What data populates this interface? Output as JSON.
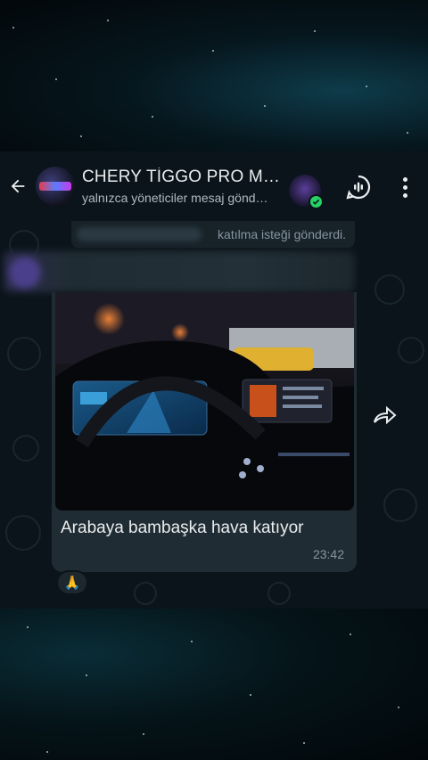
{
  "header": {
    "title": "CHERY TİGGO PRO M…",
    "subtitle": "yalnızca yöneticiler mesaj gönd…",
    "group_avatar_icon": "chery-tiggo-pro-logo",
    "member_badge_icon": "check-icon",
    "voice_chat_icon": "voice-chat-icon",
    "menu_icon": "more-vertical-icon"
  },
  "system_message": {
    "text": "katılma isteği gönderdi."
  },
  "message": {
    "caption": "Arabaya bambaşka hava katıyor",
    "time": "23:42",
    "reaction": "🙏"
  },
  "colors": {
    "header_bg": "#0b141a",
    "bubble_bg": "#202c33",
    "accent_green": "#25d366",
    "text_primary": "#e9edef",
    "text_secondary": "#8696a0"
  }
}
